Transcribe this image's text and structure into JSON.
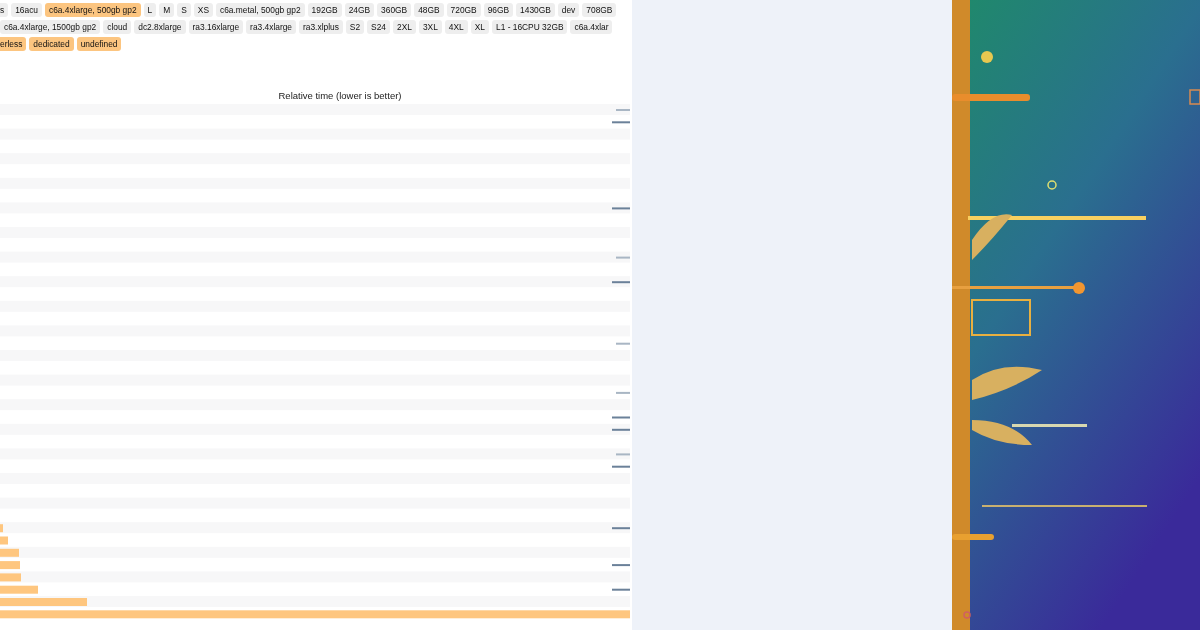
{
  "filter_rows": [
    {
      "tags": [
        {
          "label": "s",
          "selected": false
        },
        {
          "label": "16acu",
          "selected": false
        },
        {
          "label": "c6a.4xlarge, 500gb gp2",
          "selected": true
        },
        {
          "label": "L",
          "selected": false
        },
        {
          "label": "M",
          "selected": false
        },
        {
          "label": "S",
          "selected": false
        },
        {
          "label": "XS",
          "selected": false
        },
        {
          "label": "c6a.metal, 500gb gp2",
          "selected": false
        },
        {
          "label": "192GB",
          "selected": false
        },
        {
          "label": "24GB",
          "selected": false
        },
        {
          "label": "360GB",
          "selected": false
        },
        {
          "label": "48GB",
          "selected": false
        },
        {
          "label": "720GB",
          "selected": false
        },
        {
          "label": "96GB",
          "selected": false
        },
        {
          "label": "1430GB",
          "selected": false
        },
        {
          "label": "dev",
          "selected": false
        },
        {
          "label": "708GB",
          "selected": false
        }
      ]
    },
    {
      "tags": [
        {
          "label": "c6a.4xlarge, 1500gb gp2",
          "selected": false
        },
        {
          "label": "cloud",
          "selected": false
        },
        {
          "label": "dc2.8xlarge",
          "selected": false
        },
        {
          "label": "ra3.16xlarge",
          "selected": false
        },
        {
          "label": "ra3.4xlarge",
          "selected": false
        },
        {
          "label": "ra3.xlplus",
          "selected": false
        },
        {
          "label": "S2",
          "selected": false
        },
        {
          "label": "S24",
          "selected": false
        },
        {
          "label": "2XL",
          "selected": false
        },
        {
          "label": "3XL",
          "selected": false
        },
        {
          "label": "4XL",
          "selected": false
        },
        {
          "label": "XL",
          "selected": false
        },
        {
          "label": "L1 - 16CPU 32GB",
          "selected": false
        },
        {
          "label": "c6a.4xlar",
          "selected": false
        }
      ]
    },
    {
      "tags": [
        {
          "label": "erless",
          "selected": true
        },
        {
          "label": "dedicated",
          "selected": true
        },
        {
          "label": "undefined",
          "selected": true
        }
      ]
    }
  ],
  "chart": {
    "title": "Relative time (lower is better)"
  }
}
